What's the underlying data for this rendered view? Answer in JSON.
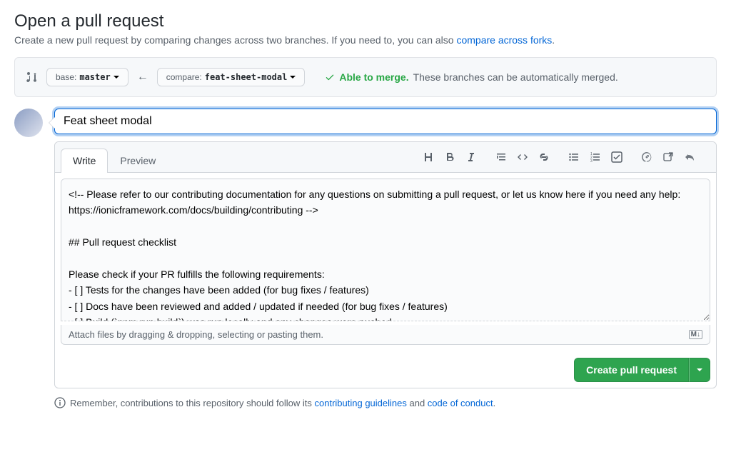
{
  "header": {
    "title": "Open a pull request",
    "subtitle_prefix": "Create a new pull request by comparing changes across two branches. If you need to, you can also ",
    "subtitle_link": "compare across forks",
    "subtitle_suffix": "."
  },
  "compare": {
    "base_label": "base:",
    "base_value": "master",
    "compare_label": "compare:",
    "compare_value": "feat-sheet-modal",
    "merge_able": "Able to merge.",
    "merge_text": "These branches can be automatically merged."
  },
  "pr": {
    "title": "Feat sheet modal",
    "body": "<!-- Please refer to our contributing documentation for any questions on submitting a pull request, or let us know here if you need any help: https://ionicframework.com/docs/building/contributing -->\n\n## Pull request checklist\n\nPlease check if your PR fulfills the following requirements:\n- [ ] Tests for the changes have been added (for bug fixes / features)\n- [ ] Docs have been reviewed and added / updated if needed (for bug fixes / features)\n- [ ] Build (`npm run build`) was run locally and any changes were pushed"
  },
  "tabs": {
    "write": "Write",
    "preview": "Preview"
  },
  "attach_hint": "Attach files by dragging & dropping, selecting or pasting them.",
  "md_badge": "M↓",
  "actions": {
    "create": "Create pull request"
  },
  "footer": {
    "prefix": "Remember, contributions to this repository should follow its ",
    "link1": "contributing guidelines",
    "mid": " and ",
    "link2": "code of conduct",
    "suffix": "."
  }
}
